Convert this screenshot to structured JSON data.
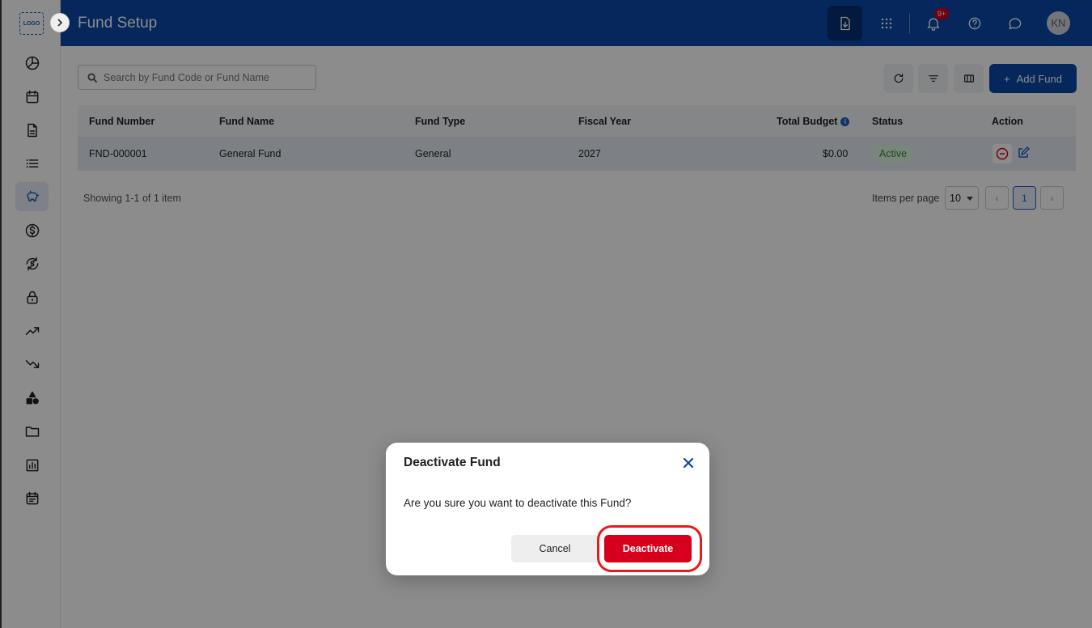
{
  "brand": {
    "logo_text": "LOGO",
    "primary_color": "#0a47a8",
    "danger_color": "#d6001c"
  },
  "header": {
    "title": "Fund Setup",
    "notification_badge": "9+",
    "avatar_initials": "KN"
  },
  "sidebar": {
    "items": [
      {
        "icon": "dashboard-icon"
      },
      {
        "icon": "calendar-icon"
      },
      {
        "icon": "document-icon"
      },
      {
        "icon": "list-icon"
      },
      {
        "icon": "piggy-bank-icon",
        "active": true
      },
      {
        "icon": "dollar-icon"
      },
      {
        "icon": "currency-exchange-icon"
      },
      {
        "icon": "lock-icon"
      },
      {
        "icon": "trending-up-icon"
      },
      {
        "icon": "trending-down-icon"
      },
      {
        "icon": "shapes-icon"
      },
      {
        "icon": "folder-icon"
      },
      {
        "icon": "bar-chart-icon"
      },
      {
        "icon": "event-note-icon"
      }
    ]
  },
  "toolbar": {
    "search_placeholder": "Search by Fund Code or Fund Name",
    "add_label": "Add Fund"
  },
  "table": {
    "columns": {
      "fund_number": "Fund Number",
      "fund_name": "Fund Name",
      "fund_type": "Fund Type",
      "fiscal_year": "Fiscal Year",
      "total_budget": "Total Budget",
      "status": "Status",
      "action": "Action"
    },
    "rows": [
      {
        "fund_number": "FND-000001",
        "fund_name": "General Fund",
        "fund_type": "General",
        "fiscal_year": "2027",
        "total_budget": "$0.00",
        "status": "Active"
      }
    ]
  },
  "pagination": {
    "showing": "Showing 1-1 of 1 item",
    "items_per_page_label": "Items per page",
    "items_per_page": "10",
    "current_page": "1"
  },
  "modal": {
    "title": "Deactivate Fund",
    "message": "Are you sure you want to deactivate this Fund?",
    "cancel_label": "Cancel",
    "confirm_label": "Deactivate"
  }
}
